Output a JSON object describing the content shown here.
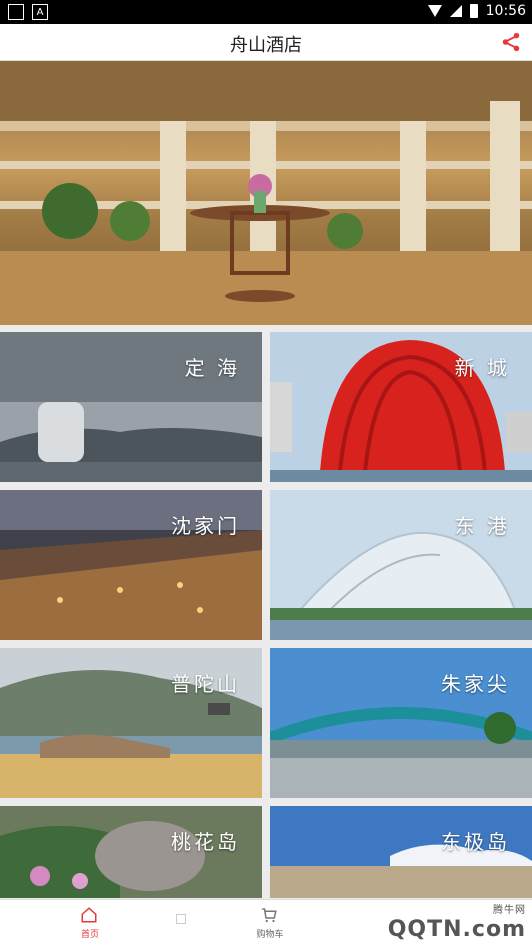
{
  "status_bar": {
    "time": "10:56"
  },
  "header": {
    "title": "舟山酒店"
  },
  "tiles": [
    {
      "label": "定 海"
    },
    {
      "label": "新 城"
    },
    {
      "label": "沈家门"
    },
    {
      "label": "东 港"
    },
    {
      "label": "普陀山"
    },
    {
      "label": "朱家尖"
    },
    {
      "label": "桃花岛"
    },
    {
      "label": "东极岛"
    }
  ],
  "bottom_nav": {
    "home_label": "首页",
    "cart_label": "购物车"
  },
  "watermark": {
    "text": "QQTN.com",
    "sub": "腾牛网"
  },
  "colors": {
    "accent": "#e43a3a"
  }
}
